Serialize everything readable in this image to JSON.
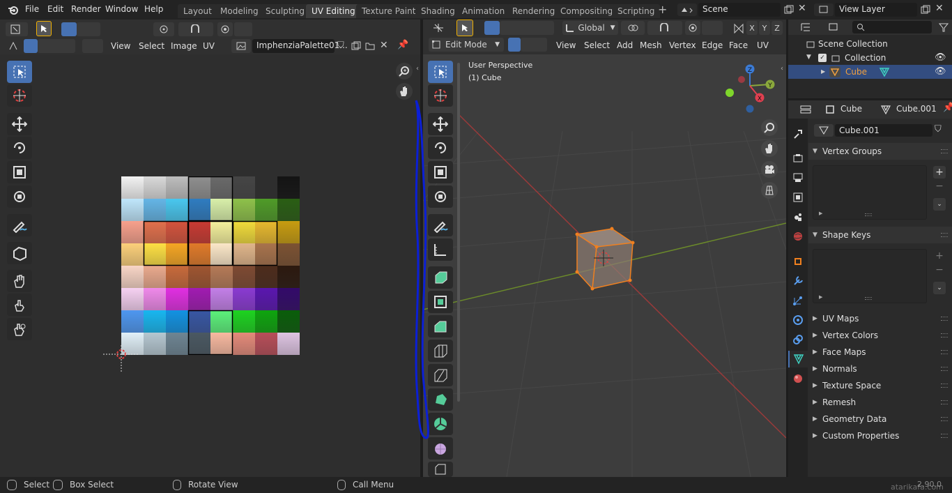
{
  "top_menu": [
    "File",
    "Edit",
    "Render",
    "Window",
    "Help"
  ],
  "workspace_tabs": [
    "Layout",
    "Modeling",
    "Sculpting",
    "UV Editing",
    "Texture Paint",
    "Shading",
    "Animation",
    "Rendering",
    "Compositing",
    "Scripting"
  ],
  "active_workspace": "UV Editing",
  "scene_name": "Scene",
  "view_layer": "View Layer",
  "uv_editor": {
    "menus": [
      "View",
      "Select",
      "Image",
      "UV"
    ],
    "image_name": "ImphenziaPalette01..."
  },
  "viewport": {
    "mode": "Edit Mode",
    "menus": [
      "View",
      "Select",
      "Add",
      "Mesh",
      "Vertex",
      "Edge",
      "Face",
      "UV"
    ],
    "transform_orientation": "Global",
    "axes": [
      "X",
      "Y",
      "Z"
    ],
    "perspective_label": "User Perspective",
    "object_label": "(1) Cube",
    "gizmo": {
      "x": "X",
      "y": "Y",
      "z": "Z"
    }
  },
  "outliner": {
    "scene_collection": "Scene Collection",
    "collection": "Collection",
    "object": "Cube"
  },
  "properties": {
    "object_name": "Cube",
    "mesh_name": "Cube.001",
    "data_field": "Cube.001",
    "panels_open": [
      "Vertex Groups",
      "Shape Keys"
    ],
    "panels_closed": [
      "UV Maps",
      "Vertex Colors",
      "Face Maps",
      "Normals",
      "Texture Space",
      "Remesh",
      "Geometry Data",
      "Custom Properties"
    ]
  },
  "statusbar": {
    "select": "Select",
    "box_select": "Box Select",
    "rotate_view": "Rotate View",
    "call_menu": "Call Menu",
    "version": "2.90.0",
    "watermark": "atarikafa.com"
  },
  "colors": {
    "accent": "#4772b3",
    "selection_orange": "#f0801f",
    "annotation_blue": "#0b1fd6"
  }
}
